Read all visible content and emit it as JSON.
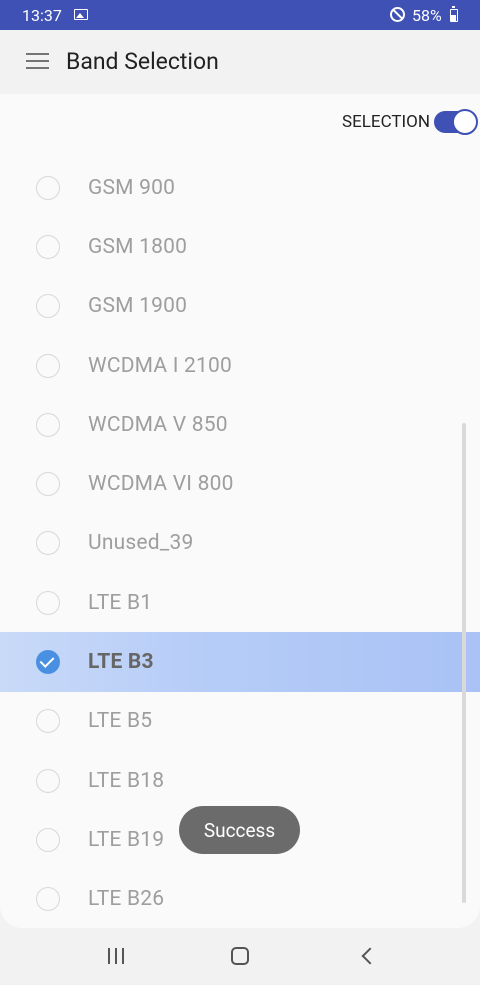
{
  "status_bar": {
    "time": "13:37",
    "battery": "58%"
  },
  "app_bar": {
    "title": "Band Selection"
  },
  "selection": {
    "label": "SELECTION",
    "enabled": true
  },
  "bands": [
    {
      "label": "GSM 900",
      "checked": false
    },
    {
      "label": "GSM 1800",
      "checked": false
    },
    {
      "label": "GSM 1900",
      "checked": false
    },
    {
      "label": "WCDMA I 2100",
      "checked": false
    },
    {
      "label": "WCDMA V 850",
      "checked": false
    },
    {
      "label": "WCDMA VI 800",
      "checked": false
    },
    {
      "label": "Unused_39",
      "checked": false
    },
    {
      "label": "LTE B1",
      "checked": false
    },
    {
      "label": "LTE B3",
      "checked": true
    },
    {
      "label": "LTE B5",
      "checked": false
    },
    {
      "label": "LTE B18",
      "checked": false
    },
    {
      "label": "LTE B19",
      "checked": false
    },
    {
      "label": "LTE B26",
      "checked": false
    }
  ],
  "toast": {
    "message": "Success"
  },
  "colors": {
    "accent": "#3f51b5",
    "selected_row": "#b7cdf8",
    "check": "#4a90e2"
  }
}
